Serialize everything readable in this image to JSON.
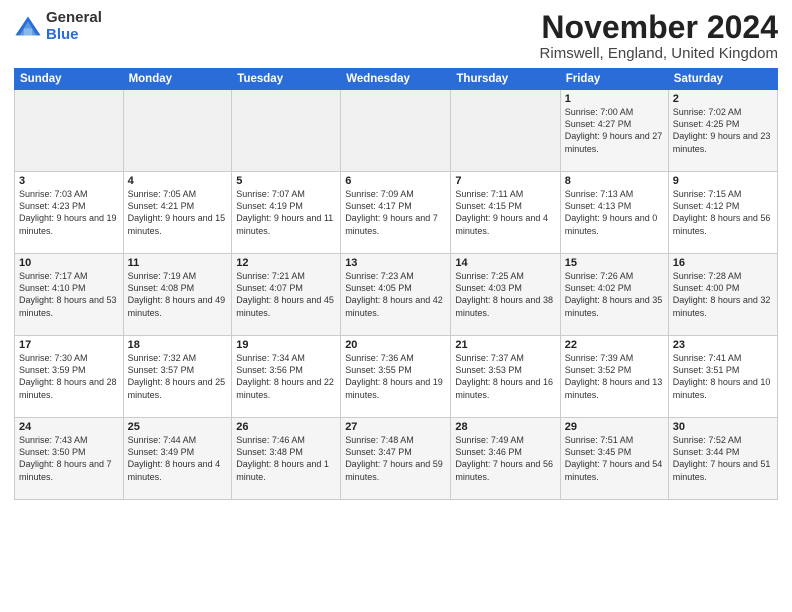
{
  "logo": {
    "general": "General",
    "blue": "Blue"
  },
  "title": {
    "month": "November 2024",
    "location": "Rimswell, England, United Kingdom"
  },
  "weekdays": [
    "Sunday",
    "Monday",
    "Tuesday",
    "Wednesday",
    "Thursday",
    "Friday",
    "Saturday"
  ],
  "weeks": [
    [
      {
        "day": "",
        "info": ""
      },
      {
        "day": "",
        "info": ""
      },
      {
        "day": "",
        "info": ""
      },
      {
        "day": "",
        "info": ""
      },
      {
        "day": "",
        "info": ""
      },
      {
        "day": "1",
        "info": "Sunrise: 7:00 AM\nSunset: 4:27 PM\nDaylight: 9 hours\nand 27 minutes."
      },
      {
        "day": "2",
        "info": "Sunrise: 7:02 AM\nSunset: 4:25 PM\nDaylight: 9 hours\nand 23 minutes."
      }
    ],
    [
      {
        "day": "3",
        "info": "Sunrise: 7:03 AM\nSunset: 4:23 PM\nDaylight: 9 hours\nand 19 minutes."
      },
      {
        "day": "4",
        "info": "Sunrise: 7:05 AM\nSunset: 4:21 PM\nDaylight: 9 hours\nand 15 minutes."
      },
      {
        "day": "5",
        "info": "Sunrise: 7:07 AM\nSunset: 4:19 PM\nDaylight: 9 hours\nand 11 minutes."
      },
      {
        "day": "6",
        "info": "Sunrise: 7:09 AM\nSunset: 4:17 PM\nDaylight: 9 hours\nand 7 minutes."
      },
      {
        "day": "7",
        "info": "Sunrise: 7:11 AM\nSunset: 4:15 PM\nDaylight: 9 hours\nand 4 minutes."
      },
      {
        "day": "8",
        "info": "Sunrise: 7:13 AM\nSunset: 4:13 PM\nDaylight: 9 hours\nand 0 minutes."
      },
      {
        "day": "9",
        "info": "Sunrise: 7:15 AM\nSunset: 4:12 PM\nDaylight: 8 hours\nand 56 minutes."
      }
    ],
    [
      {
        "day": "10",
        "info": "Sunrise: 7:17 AM\nSunset: 4:10 PM\nDaylight: 8 hours\nand 53 minutes."
      },
      {
        "day": "11",
        "info": "Sunrise: 7:19 AM\nSunset: 4:08 PM\nDaylight: 8 hours\nand 49 minutes."
      },
      {
        "day": "12",
        "info": "Sunrise: 7:21 AM\nSunset: 4:07 PM\nDaylight: 8 hours\nand 45 minutes."
      },
      {
        "day": "13",
        "info": "Sunrise: 7:23 AM\nSunset: 4:05 PM\nDaylight: 8 hours\nand 42 minutes."
      },
      {
        "day": "14",
        "info": "Sunrise: 7:25 AM\nSunset: 4:03 PM\nDaylight: 8 hours\nand 38 minutes."
      },
      {
        "day": "15",
        "info": "Sunrise: 7:26 AM\nSunset: 4:02 PM\nDaylight: 8 hours\nand 35 minutes."
      },
      {
        "day": "16",
        "info": "Sunrise: 7:28 AM\nSunset: 4:00 PM\nDaylight: 8 hours\nand 32 minutes."
      }
    ],
    [
      {
        "day": "17",
        "info": "Sunrise: 7:30 AM\nSunset: 3:59 PM\nDaylight: 8 hours\nand 28 minutes."
      },
      {
        "day": "18",
        "info": "Sunrise: 7:32 AM\nSunset: 3:57 PM\nDaylight: 8 hours\nand 25 minutes."
      },
      {
        "day": "19",
        "info": "Sunrise: 7:34 AM\nSunset: 3:56 PM\nDaylight: 8 hours\nand 22 minutes."
      },
      {
        "day": "20",
        "info": "Sunrise: 7:36 AM\nSunset: 3:55 PM\nDaylight: 8 hours\nand 19 minutes."
      },
      {
        "day": "21",
        "info": "Sunrise: 7:37 AM\nSunset: 3:53 PM\nDaylight: 8 hours\nand 16 minutes."
      },
      {
        "day": "22",
        "info": "Sunrise: 7:39 AM\nSunset: 3:52 PM\nDaylight: 8 hours\nand 13 minutes."
      },
      {
        "day": "23",
        "info": "Sunrise: 7:41 AM\nSunset: 3:51 PM\nDaylight: 8 hours\nand 10 minutes."
      }
    ],
    [
      {
        "day": "24",
        "info": "Sunrise: 7:43 AM\nSunset: 3:50 PM\nDaylight: 8 hours\nand 7 minutes."
      },
      {
        "day": "25",
        "info": "Sunrise: 7:44 AM\nSunset: 3:49 PM\nDaylight: 8 hours\nand 4 minutes."
      },
      {
        "day": "26",
        "info": "Sunrise: 7:46 AM\nSunset: 3:48 PM\nDaylight: 8 hours\nand 1 minute."
      },
      {
        "day": "27",
        "info": "Sunrise: 7:48 AM\nSunset: 3:47 PM\nDaylight: 7 hours\nand 59 minutes."
      },
      {
        "day": "28",
        "info": "Sunrise: 7:49 AM\nSunset: 3:46 PM\nDaylight: 7 hours\nand 56 minutes."
      },
      {
        "day": "29",
        "info": "Sunrise: 7:51 AM\nSunset: 3:45 PM\nDaylight: 7 hours\nand 54 minutes."
      },
      {
        "day": "30",
        "info": "Sunrise: 7:52 AM\nSunset: 3:44 PM\nDaylight: 7 hours\nand 51 minutes."
      }
    ]
  ]
}
